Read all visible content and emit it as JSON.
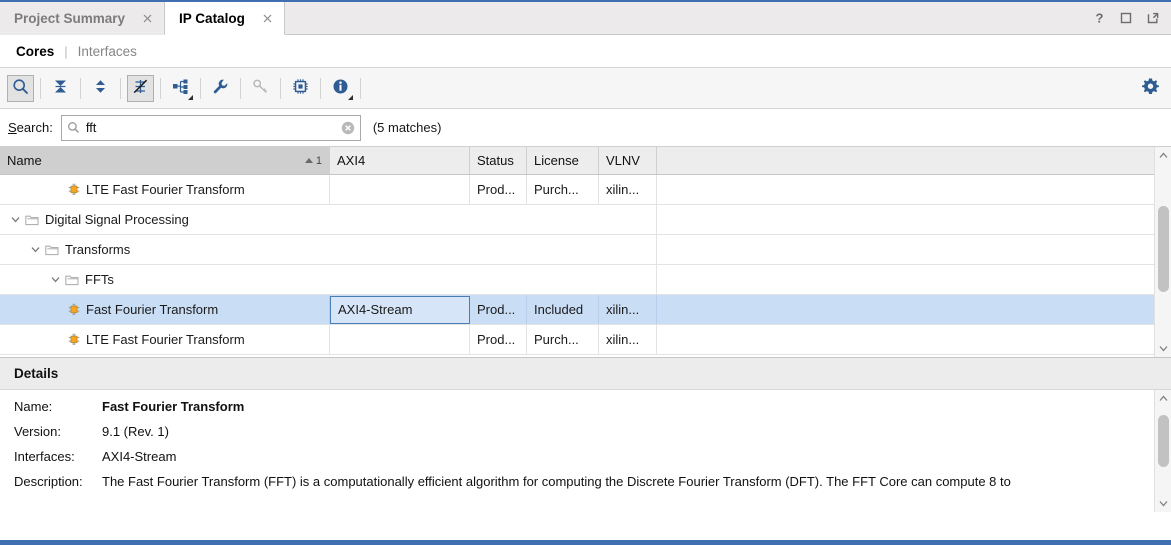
{
  "window": {
    "tabs": [
      {
        "label": "Project Summary",
        "active": false,
        "close_icon": "close-icon"
      },
      {
        "label": "IP Catalog",
        "active": true,
        "close_icon": "close-icon"
      }
    ],
    "controls": [
      {
        "name": "help-button",
        "glyph": "?"
      },
      {
        "name": "maximize-button",
        "glyph": "□"
      },
      {
        "name": "float-button",
        "glyph": "⬈"
      }
    ]
  },
  "subtabs": {
    "items": [
      {
        "label": "Cores",
        "active": true
      },
      {
        "label": "Interfaces",
        "active": false
      }
    ],
    "divider": "|"
  },
  "toolbar": {
    "buttons": [
      {
        "name": "search-toolbar-button",
        "icon": "search-icon",
        "pressed": true,
        "caret": false
      },
      {
        "name": "collapse-all-button",
        "icon": "collapse-all-icon",
        "pressed": false,
        "caret": false
      },
      {
        "name": "expand-all-button",
        "icon": "expand-all-icon",
        "pressed": false,
        "caret": false
      },
      {
        "name": "hide-unavailable-button",
        "icon": "strikethrough-pin-icon",
        "pressed": true,
        "caret": false
      },
      {
        "name": "group-by-button",
        "icon": "hierarchy-icon",
        "pressed": false,
        "caret": true
      },
      {
        "name": "settings-wrench-button",
        "icon": "wrench-icon",
        "pressed": false,
        "caret": false
      },
      {
        "name": "license-key-button",
        "icon": "key-icon",
        "pressed": false,
        "caret": false,
        "disabled": true
      },
      {
        "name": "ip-core-button",
        "icon": "chip-icon",
        "pressed": false,
        "caret": false
      },
      {
        "name": "info-button",
        "icon": "info-icon",
        "pressed": false,
        "caret": true
      }
    ],
    "gear": {
      "name": "catalog-settings-gear",
      "icon": "gear-icon"
    }
  },
  "search": {
    "label_prefix": "S",
    "label_rest": "earch:",
    "value": "fft",
    "placeholder": "",
    "clear_icon": "clear-icon",
    "search_icon": "search-icon",
    "match_count": "(5 matches)"
  },
  "table": {
    "columns": [
      {
        "key": "name",
        "label": "Name",
        "sorted": true,
        "sort_dir": "asc",
        "sort_order": "1"
      },
      {
        "key": "axi4",
        "label": "AXI4",
        "sorted": false
      },
      {
        "key": "status",
        "label": "Status",
        "sorted": false
      },
      {
        "key": "license",
        "label": "License",
        "sorted": false
      },
      {
        "key": "vlnv",
        "label": "VLNV",
        "sorted": false
      }
    ],
    "rows": [
      {
        "type": "ip",
        "indent": 3,
        "icon": "ip-core-icon",
        "name": "LTE Fast Fourier Transform",
        "axi4": "",
        "status": "Prod...",
        "license": "Purch...",
        "vlnv": "xilin...",
        "selected": false,
        "focused_cell": null
      },
      {
        "type": "group",
        "indent": 0,
        "icon": "folder-icon",
        "expanded": true,
        "name": "Digital Signal Processing",
        "axi4": "",
        "status": "",
        "license": "",
        "vlnv": "",
        "selected": false,
        "focused_cell": null
      },
      {
        "type": "group",
        "indent": 1,
        "icon": "folder-icon",
        "expanded": true,
        "name": "Transforms",
        "axi4": "",
        "status": "",
        "license": "",
        "vlnv": "",
        "selected": false,
        "focused_cell": null
      },
      {
        "type": "group",
        "indent": 2,
        "icon": "folder-icon",
        "expanded": true,
        "name": "FFTs",
        "axi4": "",
        "status": "",
        "license": "",
        "vlnv": "",
        "selected": false,
        "focused_cell": null
      },
      {
        "type": "ip",
        "indent": 3,
        "icon": "ip-core-icon",
        "name": "Fast Fourier Transform",
        "axi4": "AXI4-Stream",
        "status": "Prod...",
        "license": "Included",
        "vlnv": "xilin...",
        "selected": true,
        "focused_cell": "axi4"
      },
      {
        "type": "ip",
        "indent": 3,
        "icon": "ip-core-icon",
        "name": "LTE Fast Fourier Transform",
        "axi4": "",
        "status": "Prod...",
        "license": "Purch...",
        "vlnv": "xilin...",
        "selected": false,
        "focused_cell": null
      }
    ],
    "scrollbar": {
      "up_icon": "chevron-up-icon",
      "down_icon": "chevron-down-icon"
    }
  },
  "details": {
    "title": "Details",
    "fields": [
      {
        "label": "Name:",
        "value": "Fast Fourier Transform",
        "bold": true
      },
      {
        "label": "Version:",
        "value": "9.1 (Rev. 1)",
        "bold": false
      },
      {
        "label": "Interfaces:",
        "value": "AXI4-Stream",
        "bold": false
      },
      {
        "label": "Description:",
        "value": "The Fast Fourier Transform (FFT) is a computationally efficient algorithm for computing the Discrete Fourier Transform (DFT). The FFT Core can compute 8 to",
        "bold": false
      }
    ],
    "scrollbar": {
      "up_icon": "chevron-up-icon",
      "down_icon": "chevron-down-icon"
    }
  },
  "colors": {
    "accent": "#3f6fb0",
    "icon_blue": "#2e5c93",
    "ip_orange": "#f5a623",
    "selection": "#c9ddf5",
    "header_bg": "#ededed",
    "sorted_col": "#cfcfcf"
  }
}
